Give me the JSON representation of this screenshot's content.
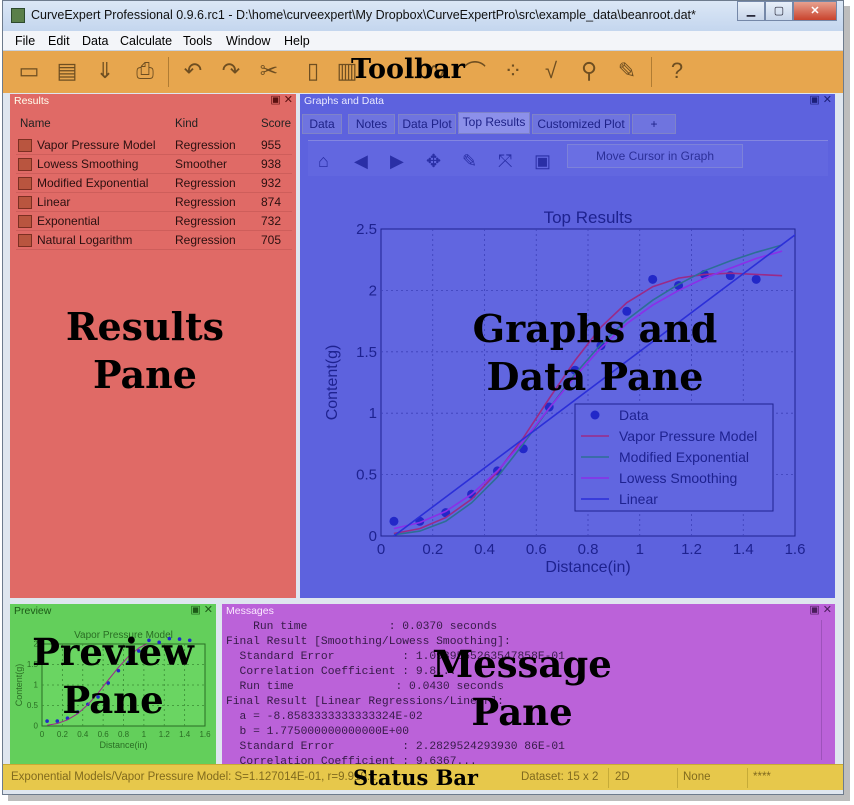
{
  "window": {
    "title": "CurveExpert Professional 0.9.6.rc1 - D:\\home\\curveexpert\\My Dropbox\\CurveExpertPro\\src\\example_data\\beanroot.dat*",
    "minimize": "▁",
    "maximize": "▢",
    "close": "✕"
  },
  "menu": [
    "File",
    "Edit",
    "Data",
    "Calculate",
    "Tools",
    "Window",
    "Help"
  ],
  "toolbar": {
    "overlay": "Toolbar"
  },
  "results": {
    "title": "Results",
    "cols": {
      "name": "Name",
      "kind": "Kind",
      "score": "Score"
    },
    "rows": [
      {
        "name": "Vapor Pressure Model",
        "kind": "Regression",
        "score": "955"
      },
      {
        "name": "Lowess Smoothing",
        "kind": "Smoother",
        "score": "938"
      },
      {
        "name": "Modified Exponential",
        "kind": "Regression",
        "score": "932"
      },
      {
        "name": "Linear",
        "kind": "Regression",
        "score": "874"
      },
      {
        "name": "Exponential",
        "kind": "Regression",
        "score": "732"
      },
      {
        "name": "Natural Logarithm",
        "kind": "Regression",
        "score": "705"
      }
    ],
    "overlay1": "Results",
    "overlay2": "Pane"
  },
  "graphs": {
    "title": "Graphs and Data",
    "tabs": [
      "Data",
      "Notes",
      "Data Plot",
      "Top Results",
      "Customized Plot",
      "+"
    ],
    "move_label": "Move Cursor in Graph",
    "overlay1": "Graphs and",
    "overlay2": "Data Pane"
  },
  "preview": {
    "title": "Preview",
    "chart_title": "Vapor Pressure Model",
    "overlay1": "Preview",
    "overlay2": "Pane"
  },
  "messages": {
    "title": "Messages",
    "lines": [
      "    Run time            : 0.0370 seconds",
      "Final Result [Smoothing/Lowess Smoothing]:",
      "  Standard Error          : 1.0939565263547858E-01",
      "  Correlation Coefficient : 9.8...",
      "  Run time               : 0.0430 seconds",
      "Final Result [Linear Regressions/Linear]:",
      "  a = -8.8583333333333324E-02",
      "  b = 1.775000000000000E+00",
      "  Standard Error          : 2.2829524293930 86E-01",
      "  Correlation Coefficient : 9.6367...",
      ""
    ],
    "overlay1": "Message",
    "overlay2": "Pane"
  },
  "status": {
    "text": "Exponential Models/Vapor Pressure Model: S=1.127014E-01, r=9.919...",
    "overlay": "Status Bar",
    "dataset": "Dataset: 15 x 2",
    "dim": "2D",
    "mode": "None",
    "stars": "****"
  },
  "chart_data": {
    "type": "scatter",
    "title": "Top Results",
    "xlabel": "Distance(in)",
    "ylabel": "Content(g)",
    "xlim": [
      0,
      1.6
    ],
    "ylim": [
      0,
      2.5
    ],
    "xticks": [
      "0",
      "0.2",
      "0.4",
      "0.6",
      "0.8",
      "1",
      "1.2",
      "1.4",
      "1.6"
    ],
    "yticks": [
      "0",
      "0.5",
      "1",
      "1.5",
      "2",
      "2.5"
    ],
    "legend_position": "lower-right",
    "legend": [
      "Data",
      "Vapor Pressure Model",
      "Modified Exponential",
      "Lowess Smoothing",
      "Linear"
    ],
    "grid": true,
    "series": [
      {
        "name": "Data",
        "type": "scatter",
        "color": "#2228c8",
        "points": [
          [
            0.05,
            0.12
          ],
          [
            0.15,
            0.12
          ],
          [
            0.25,
            0.19
          ],
          [
            0.35,
            0.34
          ],
          [
            0.45,
            0.53
          ],
          [
            0.55,
            0.71
          ],
          [
            0.65,
            1.05
          ],
          [
            0.75,
            1.35
          ],
          [
            0.85,
            1.55
          ],
          [
            0.95,
            1.83
          ],
          [
            1.05,
            2.09
          ],
          [
            1.15,
            2.04
          ],
          [
            1.25,
            2.13
          ],
          [
            1.35,
            2.12
          ],
          [
            1.45,
            2.09
          ]
        ]
      },
      {
        "name": "Vapor Pressure Model",
        "type": "line",
        "color": "#9a2a88",
        "points": [
          [
            0.05,
            0.02
          ],
          [
            0.15,
            0.06
          ],
          [
            0.25,
            0.15
          ],
          [
            0.35,
            0.3
          ],
          [
            0.45,
            0.52
          ],
          [
            0.55,
            0.8
          ],
          [
            0.65,
            1.12
          ],
          [
            0.75,
            1.43
          ],
          [
            0.85,
            1.7
          ],
          [
            0.95,
            1.9
          ],
          [
            1.05,
            2.03
          ],
          [
            1.15,
            2.1
          ],
          [
            1.25,
            2.13
          ],
          [
            1.35,
            2.14
          ],
          [
            1.45,
            2.13
          ],
          [
            1.55,
            2.12
          ]
        ]
      },
      {
        "name": "Modified Exponential",
        "type": "line",
        "color": "#2d6e96",
        "points": [
          [
            0.05,
            0.01
          ],
          [
            0.15,
            0.04
          ],
          [
            0.25,
            0.12
          ],
          [
            0.35,
            0.27
          ],
          [
            0.45,
            0.48
          ],
          [
            0.55,
            0.75
          ],
          [
            0.65,
            1.04
          ],
          [
            0.75,
            1.32
          ],
          [
            0.85,
            1.56
          ],
          [
            0.95,
            1.76
          ],
          [
            1.05,
            1.92
          ],
          [
            1.15,
            2.05
          ],
          [
            1.25,
            2.16
          ],
          [
            1.35,
            2.24
          ],
          [
            1.45,
            2.31
          ],
          [
            1.55,
            2.37
          ]
        ]
      },
      {
        "name": "Lowess Smoothing",
        "type": "line",
        "color": "#8a2fe8",
        "points": [
          [
            0.05,
            0.06
          ],
          [
            0.15,
            0.11
          ],
          [
            0.25,
            0.2
          ],
          [
            0.35,
            0.34
          ],
          [
            0.45,
            0.53
          ],
          [
            0.55,
            0.77
          ],
          [
            0.65,
            1.04
          ],
          [
            0.75,
            1.3
          ],
          [
            0.85,
            1.53
          ],
          [
            0.95,
            1.73
          ],
          [
            1.05,
            1.88
          ],
          [
            1.15,
            2.0
          ],
          [
            1.25,
            2.1
          ],
          [
            1.35,
            2.18
          ],
          [
            1.45,
            2.26
          ],
          [
            1.55,
            2.32
          ]
        ]
      },
      {
        "name": "Linear",
        "type": "line",
        "color": "#2b2fd8",
        "points": [
          [
            0.05,
            0.0
          ],
          [
            1.63,
            2.5
          ]
        ]
      }
    ]
  }
}
